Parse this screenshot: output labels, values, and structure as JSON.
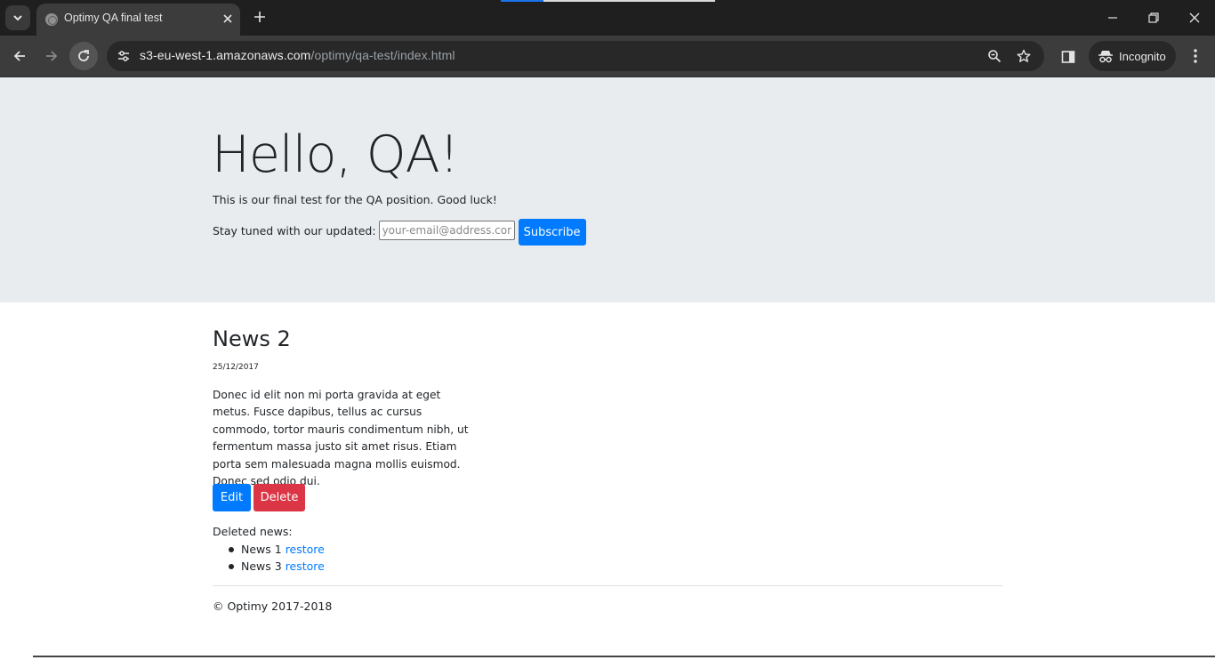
{
  "browser": {
    "tab_title": "Optimy QA final test",
    "url_host": "s3-eu-west-1.amazonaws.com",
    "url_path": "/optimy/qa-test/index.html",
    "incognito_label": "Incognito",
    "colors": {
      "frame": "#1f1f1f",
      "toolbar": "#3c3c3c",
      "omnibox": "#282828"
    }
  },
  "page": {
    "jumbotron": {
      "title": "Hello, QA!",
      "lead": "This is our final test for the QA position. Good luck!",
      "subscribe_label": "Stay tuned with our updated:",
      "email_placeholder": "your-email@address.com",
      "email_value": "",
      "subscribe_button": "Subscribe"
    },
    "news": {
      "title": "News 2",
      "date": "25/12/2017",
      "body": "Donec id elit non mi porta gravida at eget metus. Fusce dapibus, tellus ac cursus commodo, tortor mauris condimentum nibh, ut fermentum massa justo sit amet risus. Etiam porta sem malesuada magna mollis euismod. Donec sed odio dui.",
      "edit_button": "Edit",
      "delete_button": "Delete"
    },
    "deleted": {
      "label": "Deleted news:",
      "items": [
        {
          "name": "News 1",
          "action": "restore"
        },
        {
          "name": "News 3",
          "action": "restore"
        }
      ]
    },
    "footer": {
      "copyright": "© Optimy 2017-2018"
    },
    "colors": {
      "primary": "#007bff",
      "danger": "#dc3545",
      "jumbotron_bg": "#e9ecef",
      "text": "#212529"
    }
  }
}
